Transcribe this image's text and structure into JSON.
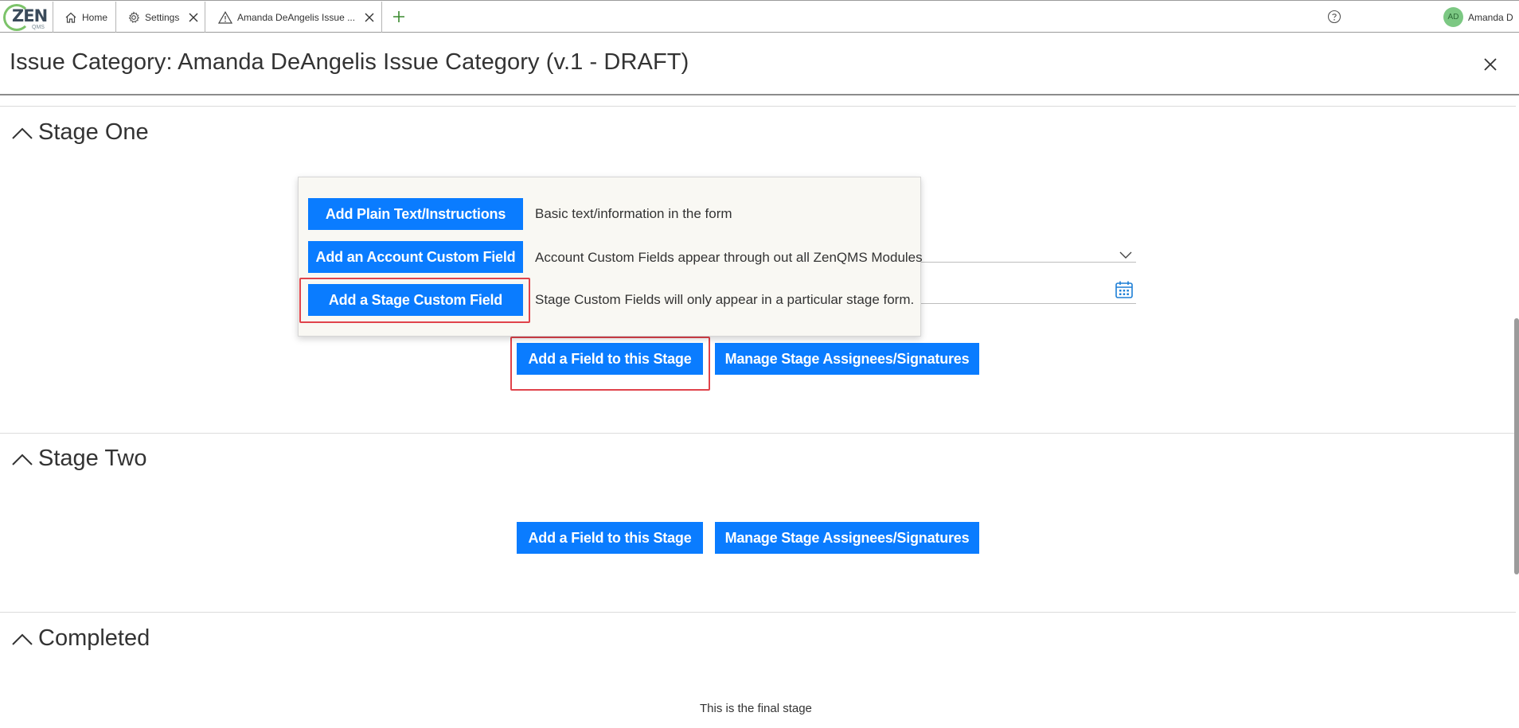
{
  "app": {
    "logo_text": "ZEN",
    "logo_sub": "QMS"
  },
  "tabs": [
    {
      "label": "Home",
      "icon": "home-icon"
    },
    {
      "label": "Settings",
      "icon": "gear-icon"
    },
    {
      "label": "Amanda DeAngelis Issue ...",
      "icon": "warning-icon"
    }
  ],
  "user": {
    "initials": "AD",
    "name": "Amanda D"
  },
  "page": {
    "title": "Issue Category: Amanda DeAngelis Issue Category (v.1 - DRAFT)"
  },
  "stages": [
    {
      "title": "Stage One",
      "add_field_label": "Add a Field to this Stage",
      "manage_label": "Manage Stage Assignees/Signatures"
    },
    {
      "title": "Stage Two",
      "add_field_label": "Add a Field to this Stage",
      "manage_label": "Manage Stage Assignees/Signatures"
    },
    {
      "title": "Completed",
      "final_text": "This is the final stage"
    }
  ],
  "field_menu": {
    "items": [
      {
        "label": "Add Plain Text/Instructions",
        "description": "Basic text/information in the form"
      },
      {
        "label": "Add an Account Custom Field",
        "description": "Account Custom Fields appear through out all ZenQMS Modules"
      },
      {
        "label": "Add a Stage Custom Field",
        "description": "Stage Custom Fields will only appear in a particular stage form."
      }
    ]
  },
  "colors": {
    "primary_button": "#0a7cff",
    "highlight": "#e0434b",
    "avatar": "#7cc883",
    "logo_green": "#7cc36a"
  }
}
